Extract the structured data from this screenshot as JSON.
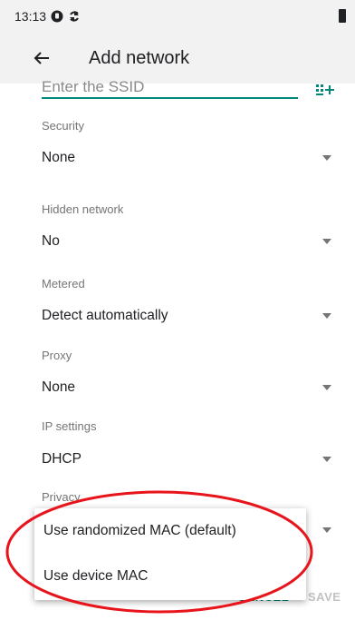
{
  "status_bar": {
    "time": "13:13",
    "icons": [
      "notification-icon",
      "sync-icon",
      "battery-icon"
    ]
  },
  "app_bar": {
    "title": "Add network",
    "back_icon": "arrow-left-icon"
  },
  "ssid": {
    "placeholder": "Enter the SSID",
    "scan_icon": "qr-scan-icon"
  },
  "fields": [
    {
      "label": "Security",
      "value": "None"
    },
    {
      "label": "Hidden network",
      "value": "No"
    },
    {
      "label": "Metered",
      "value": "Detect automatically"
    },
    {
      "label": "Proxy",
      "value": "None"
    },
    {
      "label": "IP settings",
      "value": "DHCP"
    },
    {
      "label": "Privacy",
      "value": ""
    }
  ],
  "privacy_menu": {
    "options": [
      "Use randomized MAC (default)",
      "Use device MAC"
    ]
  },
  "dialog_buttons": {
    "cancel": "CANCEL",
    "save": "SAVE"
  },
  "colors": {
    "accent": "#00897b",
    "annotation_ellipse": "#e8141b"
  }
}
